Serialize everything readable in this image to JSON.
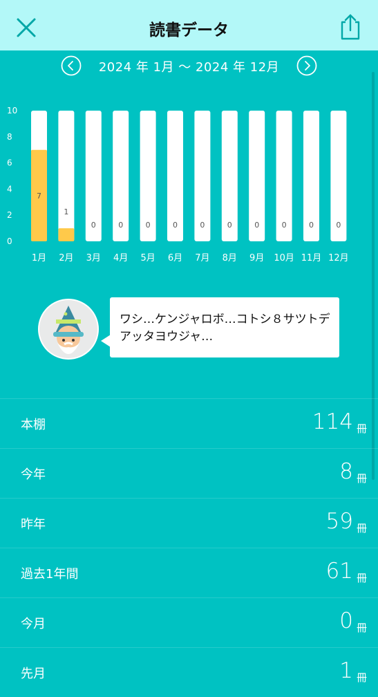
{
  "header": {
    "title": "読書データ",
    "close_icon": "close-icon",
    "share_icon": "share-icon"
  },
  "date_nav": {
    "range": "2024 年 1月 〜 2024 年 12月",
    "prev_icon": "chevron-left-icon",
    "next_icon": "chevron-right-icon"
  },
  "chart_data": {
    "type": "bar",
    "categories": [
      "1月",
      "2月",
      "3月",
      "4月",
      "5月",
      "6月",
      "7月",
      "8月",
      "9月",
      "10月",
      "11月",
      "12月"
    ],
    "values": [
      7,
      1,
      0,
      0,
      0,
      0,
      0,
      0,
      0,
      0,
      0,
      0
    ],
    "ylim": [
      0,
      10
    ],
    "yticks": [
      0,
      2,
      4,
      6,
      8,
      10
    ],
    "data_labels": true,
    "grid": false,
    "colors": {
      "bar": "#ffc94a",
      "track": "#ffffff",
      "label": "#555555"
    }
  },
  "speech": {
    "avatar_icon": "wizard-avatar-icon",
    "text": "ワシ…ケンジャロボ…コトシ８サツトデアッタヨウジャ…"
  },
  "stats": [
    {
      "label": "本棚",
      "value": "114",
      "unit": "冊"
    },
    {
      "label": "今年",
      "value": "8",
      "unit": "冊"
    },
    {
      "label": "昨年",
      "value": "59",
      "unit": "冊"
    },
    {
      "label": "過去1年間",
      "value": "61",
      "unit": "冊"
    },
    {
      "label": "今月",
      "value": "0",
      "unit": "冊"
    },
    {
      "label": "先月",
      "value": "1",
      "unit": "冊"
    }
  ],
  "colors": {
    "background": "#00c2c2",
    "header_bg": "#b3f8f8",
    "accent": "#00a7a7"
  }
}
